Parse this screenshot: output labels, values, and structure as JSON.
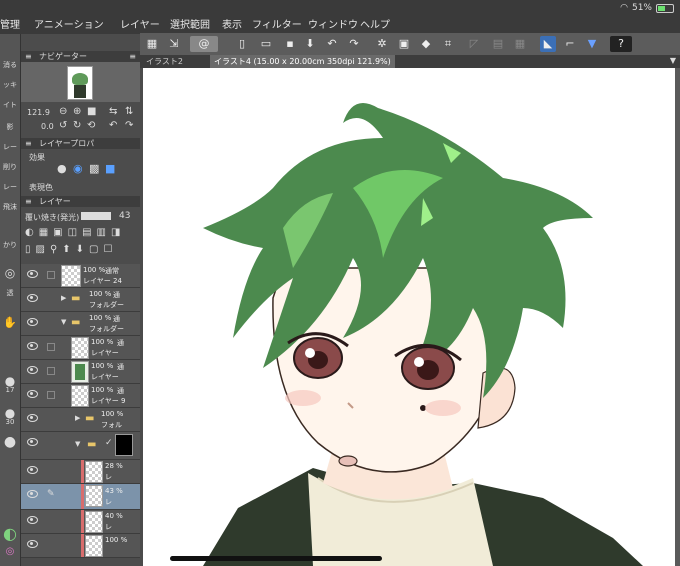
{
  "status": {
    "battery": "51%"
  },
  "menu": [
    "管理",
    "アニメーション",
    "レイヤー",
    "選択範囲",
    "表示",
    "フィルター",
    "ウィンドウ",
    "ヘルプ"
  ],
  "tabs": [
    "イラスト2",
    "イラスト4 (15.00 x 20.00cm 350dpi 121.9%)"
  ],
  "left_tools": [
    "消る",
    "ッキ",
    "イト",
    "影",
    "レー",
    "削り",
    "レー",
    "飛沫",
    "かり",
    "透"
  ],
  "navigator": {
    "title": "ナビゲーター",
    "zoom": "121.9",
    "angle": "0.0"
  },
  "layer_property": {
    "title": "レイヤープロパ",
    "effect_label": "効果",
    "color_label": "表現色"
  },
  "layer_panel": {
    "title": "レイヤー",
    "blend_mode": "覆い焼き(発光)",
    "opacity": "43"
  },
  "layers": [
    {
      "pct": "100 %",
      "mode": "通常",
      "name": "レイヤー 24"
    },
    {
      "pct": "100 %",
      "mode": "通",
      "name": "フォルダー"
    },
    {
      "pct": "100 %",
      "mode": "通",
      "name": "フォルダー"
    },
    {
      "pct": "100 %",
      "mode": "通",
      "name": "レイヤー"
    },
    {
      "pct": "100 %",
      "mode": "通",
      "name": "レイヤー"
    },
    {
      "pct": "100 %",
      "mode": "通",
      "name": "レイヤー 9"
    },
    {
      "pct": "100 %",
      "mode": "",
      "name": "フォル"
    },
    {
      "pct": "",
      "mode": "",
      "name": ""
    },
    {
      "pct": "28 %",
      "mode": "",
      "name": "レ"
    },
    {
      "pct": "43 %",
      "mode": "",
      "name": "レ"
    },
    {
      "pct": "40 %",
      "mode": "",
      "name": "レ"
    },
    {
      "pct": "100 %",
      "mode": "",
      "name": ""
    }
  ],
  "left_numbers": [
    "17",
    "30"
  ],
  "colors": {
    "hair": "#4c8a4e",
    "hair_light": "#77d26c",
    "eye": "#8a4a4a",
    "jacket": "#2f3a2c",
    "sweater": "#f1ecd8"
  }
}
